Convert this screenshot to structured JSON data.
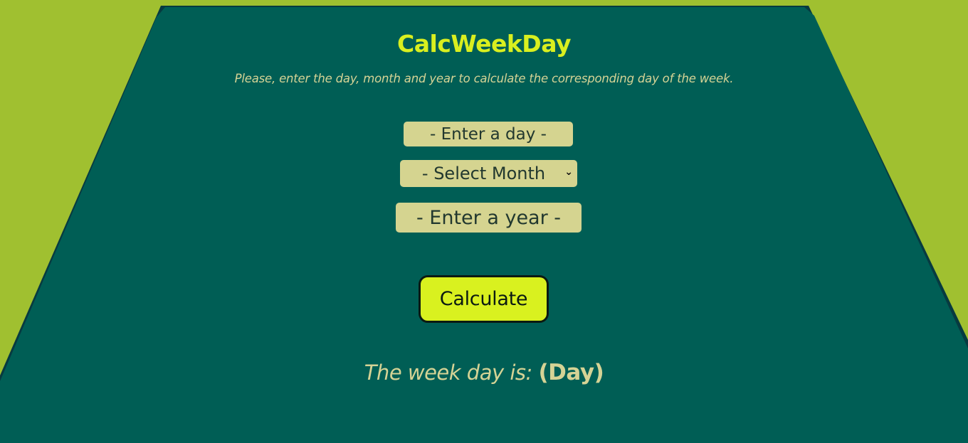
{
  "app": {
    "title": "CalcWeekDay",
    "subtitle": "Please, enter the day, month and year to calculate the corresponding day of the week."
  },
  "form": {
    "day_placeholder": "- Enter a day -",
    "month_selected": "- Select Month",
    "month_icon": "chevron-down-icon",
    "year_placeholder": "- Enter a year -",
    "calculate_label": "Calculate"
  },
  "result": {
    "prefix": "The week day is:",
    "value": "(Day)"
  },
  "colors": {
    "page_background": "#a0c030",
    "panel": "#005e55",
    "title": "#d9ef1f",
    "text": "#d5d395",
    "field_background": "#d5d490",
    "button": "#d9f11f"
  }
}
